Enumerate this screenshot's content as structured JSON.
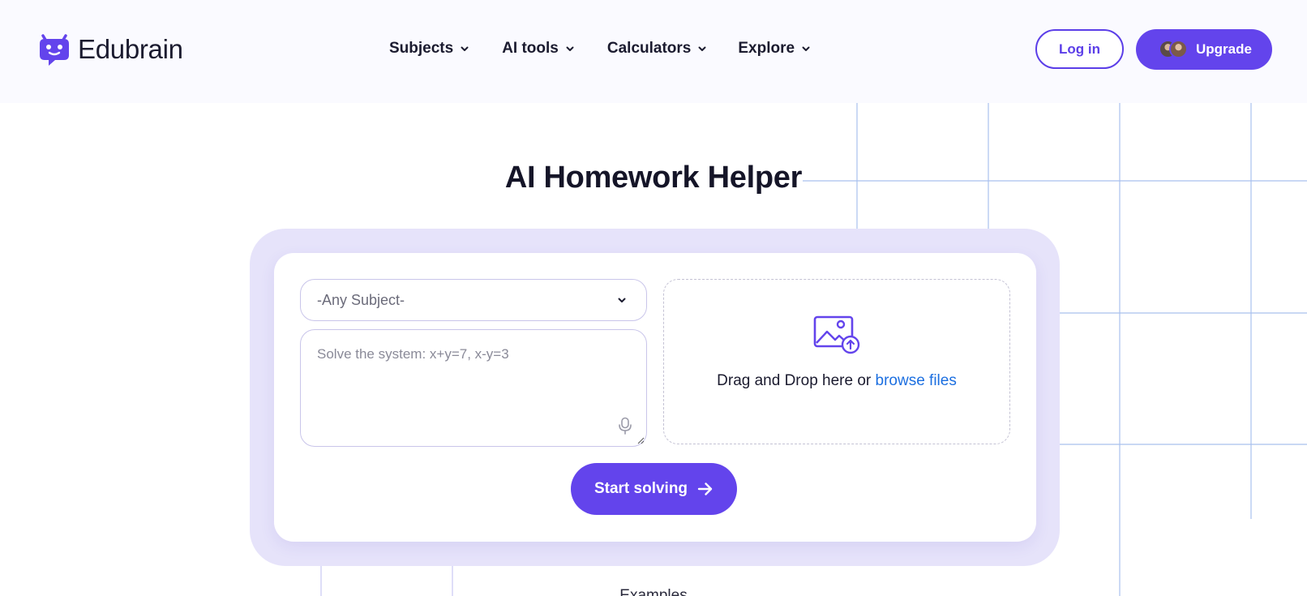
{
  "brand": {
    "name": "Edubrain",
    "color": "#6344ec"
  },
  "nav": {
    "items": [
      {
        "label": "Subjects"
      },
      {
        "label": "AI tools"
      },
      {
        "label": "Calculators"
      },
      {
        "label": "Explore"
      }
    ]
  },
  "header": {
    "login_label": "Log in",
    "upgrade_label": "Upgrade"
  },
  "hero": {
    "title": "AI Homework Helper"
  },
  "form": {
    "subject_selected": "-Any Subject-",
    "question_placeholder": "Solve the system: x+y=7, x-y=3",
    "drop_text": "Drag and Drop here or ",
    "browse_label": "browse files",
    "submit_label": "Start solving"
  },
  "below": {
    "partial_text": "Examples"
  },
  "icons": {
    "logo": "robot-chat-logo-icon",
    "nav_chevron": "chevron-down-icon",
    "select_chevron": "chevron-down-icon",
    "mic": "microphone-icon",
    "upload": "image-upload-icon",
    "arrow": "arrow-right-icon"
  },
  "colors": {
    "accent": "#6344ec",
    "frame": "#e6e3fa",
    "link": "#1c6fe0",
    "grid_line": "#a9c1ee"
  }
}
